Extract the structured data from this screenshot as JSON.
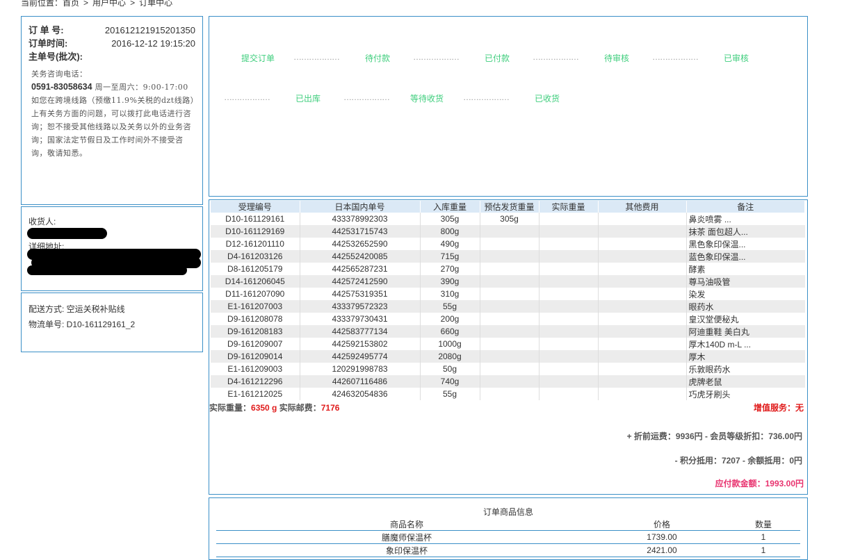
{
  "breadcrumb": {
    "prefix": "当前位置：",
    "items": [
      "首页",
      "用户中心",
      "订单中心"
    ],
    "separator": ">"
  },
  "order": {
    "number_label": "订 单 号:",
    "number": "201612121915201350",
    "time_label": "订单时间:",
    "time": "2016-12-12 19:15:20",
    "master_label": "主单号(批次):",
    "master": ""
  },
  "notice": {
    "title": "关务咨询电话：",
    "phone": "0591-83058634",
    "hours": "周一至周六：9:00-17:00",
    "text": "如您在跨境线路（预缴11.9%关税的dzt线路）上有关务方面的问题，可以拨打此电话进行咨询；恕不接受其他线路以及关务以外的业务咨询；国家法定节假日及工作时间外不接受咨询，敬请知悉。"
  },
  "receiver": {
    "name_label": "收货人:",
    "address_label": "详细地址:"
  },
  "delivery": {
    "method": "配送方式: 空运关税补贴线",
    "tracking": "物流单号: D10-161129161_2"
  },
  "status_steps": [
    "提交订单",
    "待付款",
    "已付款",
    "待审核",
    "已审核",
    "已出库",
    "等待收货",
    "已收货"
  ],
  "status_connector": "………………",
  "packages": {
    "headers": [
      "受理编号",
      "日本国内单号",
      "入库重量",
      "预估发货重量",
      "实际重量",
      "其他费用",
      "备注"
    ],
    "rows": [
      [
        "D10-161129161",
        "433378992303",
        "305g",
        "305g",
        "",
        "",
        "鼻炎喷雾 ..."
      ],
      [
        "D10-161129169",
        "442531715743",
        "800g",
        "",
        "",
        "",
        "抹茶 面包超人..."
      ],
      [
        "D12-161201110",
        "442532652590",
        "490g",
        "",
        "",
        "",
        "黑色象印保温..."
      ],
      [
        "D4-161203126",
        "442552420085",
        "715g",
        "",
        "",
        "",
        "蓝色象印保温..."
      ],
      [
        "D8-161205179",
        "442565287231",
        "270g",
        "",
        "",
        "",
        "酵素"
      ],
      [
        "D14-161206045",
        "442572412590",
        "390g",
        "",
        "",
        "",
        "尊马油吸管"
      ],
      [
        "D11-161207090",
        "442575319351",
        "310g",
        "",
        "",
        "",
        "染发"
      ],
      [
        "E1-161207003",
        "433379572323",
        "55g",
        "",
        "",
        "",
        "眼药水"
      ],
      [
        "D9-161208078",
        "433379730431",
        "200g",
        "",
        "",
        "",
        "皇汉堂便秘丸"
      ],
      [
        "D9-161208183",
        "442583777134",
        "660g",
        "",
        "",
        "",
        "阿迪重鞋 美白丸"
      ],
      [
        "D9-161209007",
        "442592153802",
        "1000g",
        "",
        "",
        "",
        "厚木140D m-L ..."
      ],
      [
        "D9-161209014",
        "442592495774",
        "2080g",
        "",
        "",
        "",
        "厚木"
      ],
      [
        "E1-161209003",
        "120291998783",
        "50g",
        "",
        "",
        "",
        "乐敦眼药水"
      ],
      [
        "D4-161212296",
        "442607116486",
        "740g",
        "",
        "",
        "",
        "虎牌老鼠"
      ],
      [
        "E1-161212025",
        "424632054836",
        "55g",
        "",
        "",
        "",
        "巧虎牙刷头"
      ]
    ]
  },
  "summary": {
    "weight_label": "实际重量：",
    "weight": "6350 g",
    "postage_label": "实际邮费：",
    "postage": "7176",
    "service": "增值服务：无",
    "line1": "+ 折前运费：9936円 - 会员等级折扣：736.00円",
    "line2": "- 积分抵用：7207 - 余额抵用：0円",
    "total": "应付款金额：1993.00円"
  },
  "goods": {
    "title": "订单商品信息",
    "headers": [
      "商品名称",
      "价格",
      "数量"
    ],
    "rows": [
      [
        "膳魔师保温杯",
        "1739.00",
        "1"
      ],
      [
        "象印保温杯",
        "2421.00",
        "1"
      ]
    ]
  },
  "colors": {
    "border": "#3a8fc7",
    "status_green": "#3fce7d",
    "highlight_red": "#e01b1b",
    "total_pink": "#e8336f",
    "table_header_bg": "#dbe9f6"
  }
}
